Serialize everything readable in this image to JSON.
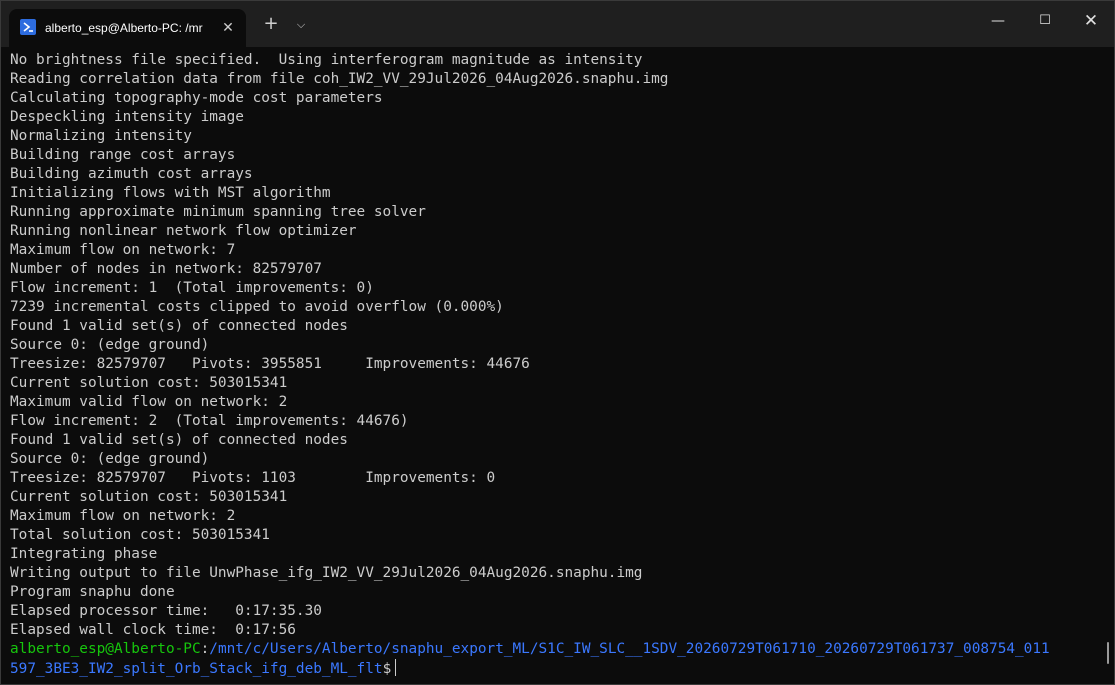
{
  "window": {
    "tab_title": "alberto_esp@Alberto-PC: /mr",
    "tab_close_glyph": "✕",
    "new_tab_glyph": "+",
    "dropdown_glyph": "⌵",
    "minimize_glyph": "—",
    "maximize_glyph": "☐",
    "close_glyph": "✕"
  },
  "terminal": {
    "lines": [
      "No brightness file specified.  Using interferogram magnitude as intensity",
      "Reading correlation data from file coh_IW2_VV_29Jul2026_04Aug2026.snaphu.img",
      "Calculating topography-mode cost parameters",
      "Despeckling intensity image",
      "Normalizing intensity",
      "Building range cost arrays",
      "Building azimuth cost arrays",
      "Initializing flows with MST algorithm",
      "Running approximate minimum spanning tree solver",
      "Running nonlinear network flow optimizer",
      "Maximum flow on network: 7",
      "Number of nodes in network: 82579707",
      "Flow increment: 1  (Total improvements: 0)",
      "7239 incremental costs clipped to avoid overflow (0.000%)",
      "Found 1 valid set(s) of connected nodes",
      "Source 0: (edge ground)",
      "Treesize: 82579707   Pivots: 3955851     Improvements: 44676",
      "Current solution cost: 503015341",
      "Maximum valid flow on network: 2",
      "Flow increment: 2  (Total improvements: 44676)",
      "Found 1 valid set(s) of connected nodes",
      "Source 0: (edge ground)",
      "Treesize: 82579707   Pivots: 1103        Improvements: 0",
      "Current solution cost: 503015341",
      "Maximum flow on network: 2",
      "Total solution cost: 503015341",
      "Integrating phase",
      "Writing output to file UnwPhase_ifg_IW2_VV_29Jul2026_04Aug2026.snaphu.img",
      "Program snaphu done",
      "Elapsed processor time:   0:17:35.30",
      "Elapsed wall clock time:  0:17:56"
    ],
    "prompt": {
      "user_host": "alberto_esp@Alberto-PC",
      "separator": ":",
      "path_line1": "/mnt/c/Users/Alberto/snaphu_export_ML/S1C_IW_SLC__1SDV_20260729T061710_20260729T061737_008754_011",
      "path_line2": "597_3BE3_IW2_split_Orb_Stack_ifg_deb_ML_flt",
      "dollar": "$"
    }
  },
  "colors": {
    "background": "#0c0c0c",
    "titlebar": "#1f1f1f",
    "text": "#cccccc",
    "prompt_user": "#16c60c",
    "prompt_path": "#3b78ff"
  }
}
